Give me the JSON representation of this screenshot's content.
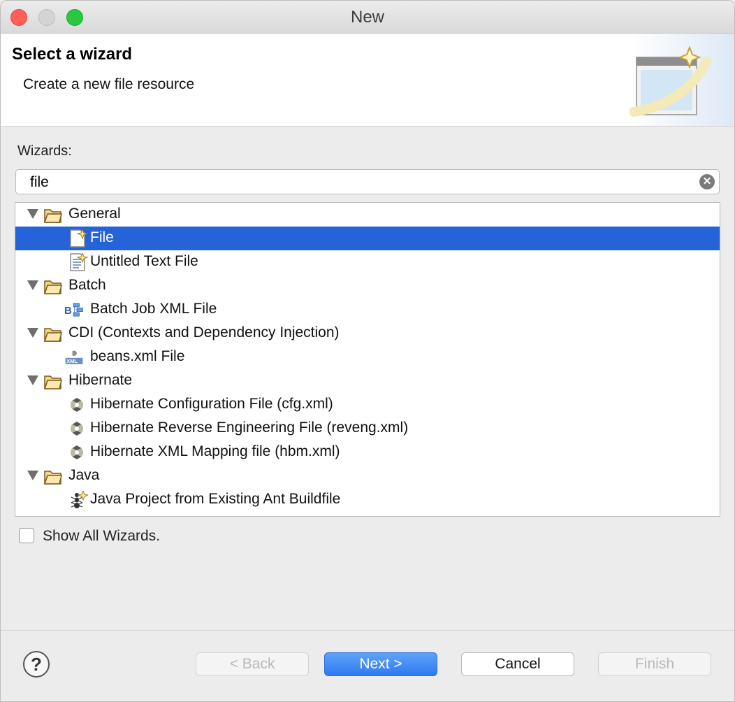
{
  "window": {
    "title": "New"
  },
  "banner": {
    "title": "Select a wizard",
    "description": "Create a new file resource",
    "icon": "new-wizard-icon"
  },
  "wizards_label": "Wizards:",
  "search": {
    "value": "file",
    "clear_icon": "clear-icon"
  },
  "tree": {
    "selected": "File",
    "rows": [
      {
        "label": "General",
        "icon": "folder-icon",
        "kind": "category",
        "expanded": true
      },
      {
        "label": "File",
        "icon": "new-file-icon",
        "kind": "item",
        "selected": true
      },
      {
        "label": "Untitled Text File",
        "icon": "new-text-file-icon",
        "kind": "item"
      },
      {
        "label": "Batch",
        "icon": "folder-icon",
        "kind": "category",
        "expanded": true
      },
      {
        "label": "Batch Job XML File",
        "icon": "batch-job-icon",
        "kind": "item"
      },
      {
        "label": "CDI (Contexts and Dependency Injection)",
        "icon": "folder-icon",
        "kind": "category",
        "expanded": true
      },
      {
        "label": "beans.xml File",
        "icon": "beans-xml-icon",
        "kind": "item"
      },
      {
        "label": "Hibernate",
        "icon": "folder-icon",
        "kind": "category",
        "expanded": true
      },
      {
        "label": "Hibernate Configuration File (cfg.xml)",
        "icon": "hibernate-icon",
        "kind": "item"
      },
      {
        "label": "Hibernate Reverse Engineering File (reveng.xml)",
        "icon": "hibernate-icon",
        "kind": "item"
      },
      {
        "label": "Hibernate XML Mapping file (hbm.xml)",
        "icon": "hibernate-icon",
        "kind": "item"
      },
      {
        "label": "Java",
        "icon": "folder-icon",
        "kind": "category",
        "expanded": true
      },
      {
        "label": "Java Project from Existing Ant Buildfile",
        "icon": "ant-project-icon",
        "kind": "item"
      }
    ]
  },
  "show_all": {
    "label": "Show All Wizards.",
    "checked": false
  },
  "buttons": {
    "back": "< Back",
    "next": "Next >",
    "cancel": "Cancel",
    "finish": "Finish",
    "back_enabled": false,
    "finish_enabled": false
  },
  "colors": {
    "selection": "#2563d9",
    "primary_button": "#3b82f6",
    "traffic_close": "#fe5f57",
    "traffic_max": "#28c840"
  }
}
